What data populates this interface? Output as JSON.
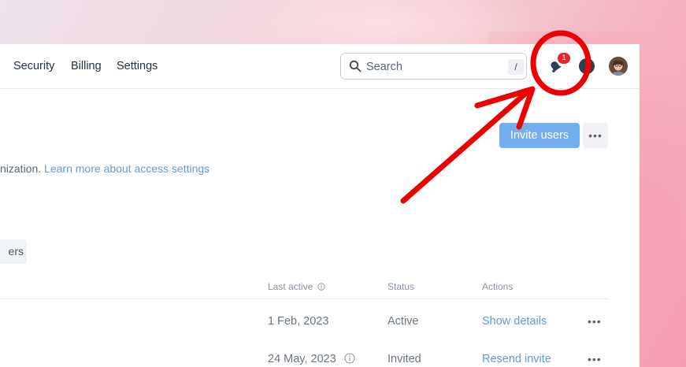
{
  "nav": {
    "items": [
      "Security",
      "Billing",
      "Settings"
    ]
  },
  "search": {
    "placeholder": "Search",
    "shortcut": "/"
  },
  "notifications": {
    "count": "1"
  },
  "header": {
    "invite_label": "Invite users",
    "more_label": "•••"
  },
  "description": {
    "text": "nization. ",
    "link": "Learn more about access settings"
  },
  "filter_tab": {
    "label": "ers"
  },
  "table": {
    "headers": {
      "last_active": "Last active",
      "status": "Status",
      "actions": "Actions"
    },
    "rows": [
      {
        "last_active": "1 Feb, 2023",
        "status": "Active",
        "action": "Show details",
        "more": "•••"
      },
      {
        "last_active": "24 May, 2023",
        "status": "Invited",
        "action": "Resend invite",
        "more": "•••"
      }
    ]
  },
  "colors": {
    "primary_button": "#74aeef",
    "link": "#5f9be0",
    "badge": "#e4262c",
    "annotation": "#ee0000"
  }
}
